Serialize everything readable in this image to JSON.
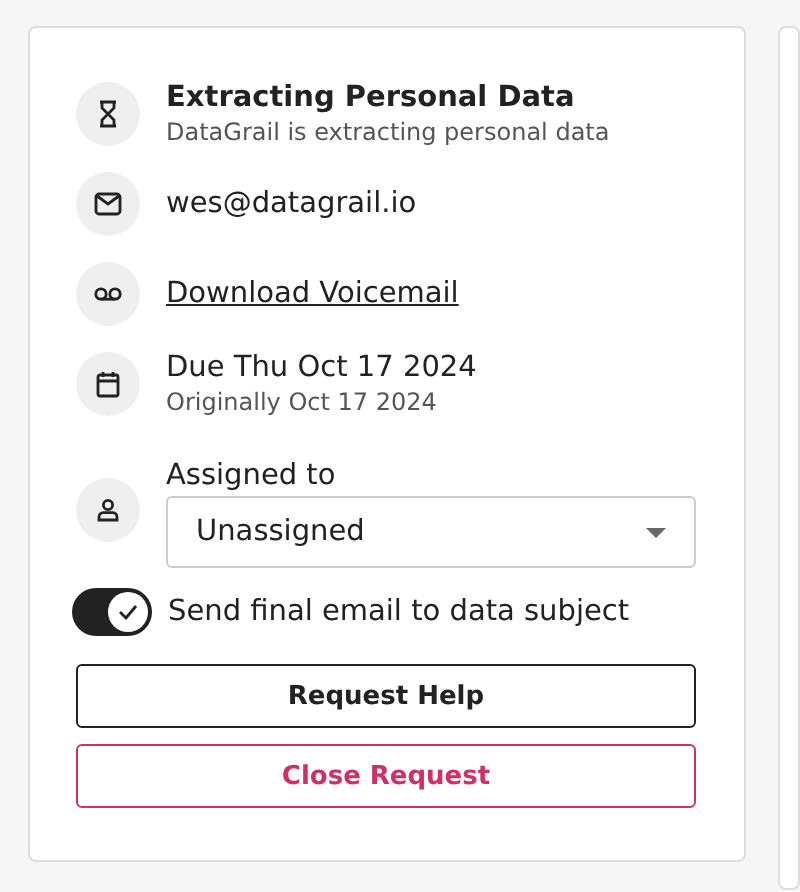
{
  "status": {
    "title": "Extracting Personal Data",
    "subtitle": "DataGrail is extracting personal data"
  },
  "email": "wes@datagrail.io",
  "voicemail_link": "Download Voicemail",
  "due": {
    "date": "Due Thu Oct 17 2024",
    "original": "Originally Oct 17 2024"
  },
  "assignee": {
    "label": "Assigned to",
    "value": "Unassigned"
  },
  "toggle": {
    "label": "Send final email to data subject",
    "on": true
  },
  "buttons": [
    {
      "label": "Request Help",
      "kind": "secondary"
    },
    {
      "label": "Close Request",
      "kind": "danger"
    }
  ]
}
